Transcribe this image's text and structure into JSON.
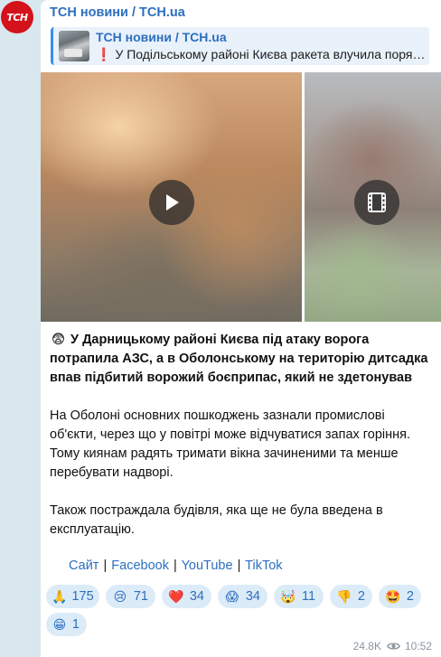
{
  "channel": {
    "avatar_text": "ТСН",
    "name": "ТСН новини / TCH.ua",
    "brand_color": "#d3121b",
    "link_color": "#2c6fbf"
  },
  "reply": {
    "title": "ТСН новини / TCH.ua",
    "mark": "❗",
    "text": "У Подільському районі Києва ракета влучила поря…"
  },
  "media": [
    {
      "type": "video",
      "icon": "play-icon"
    },
    {
      "type": "video",
      "icon": "film-icon"
    }
  ],
  "post": {
    "lead_emoji": "😨",
    "lead": "У Дарницькому районі Києва під атаку ворога потрапила АЗС, а в Оболонському на територію дитсадка впав підбитий ворожий боєприпас, який не здетонував",
    "paragraph_1": "На Оболоні основних пошкоджень зазнали промислові об'єкти, через що у повітрі може відчуватися запах горіння. Тому киянам радять тримати вікна зачиненими та менше перебувати надворі.",
    "paragraph_2": "Також постраждала будівля, яка ще не була введена в експлуатацію."
  },
  "links": [
    {
      "label": "Сайт"
    },
    {
      "label": "Facebook"
    },
    {
      "label": "YouTube"
    },
    {
      "label": "TikTok"
    }
  ],
  "reactions": [
    {
      "emoji": "🙏",
      "count": "175"
    },
    {
      "emoji": "😢",
      "count": "71"
    },
    {
      "emoji": "❤️",
      "count": "34"
    },
    {
      "emoji": "😱",
      "count": "34"
    },
    {
      "emoji": "🤯",
      "count": "11"
    },
    {
      "emoji": "👎",
      "count": "2"
    },
    {
      "emoji": "🤩",
      "count": "2"
    },
    {
      "emoji": "😁",
      "count": "1"
    }
  ],
  "meta": {
    "views": "24.8K",
    "time": "10:52"
  }
}
